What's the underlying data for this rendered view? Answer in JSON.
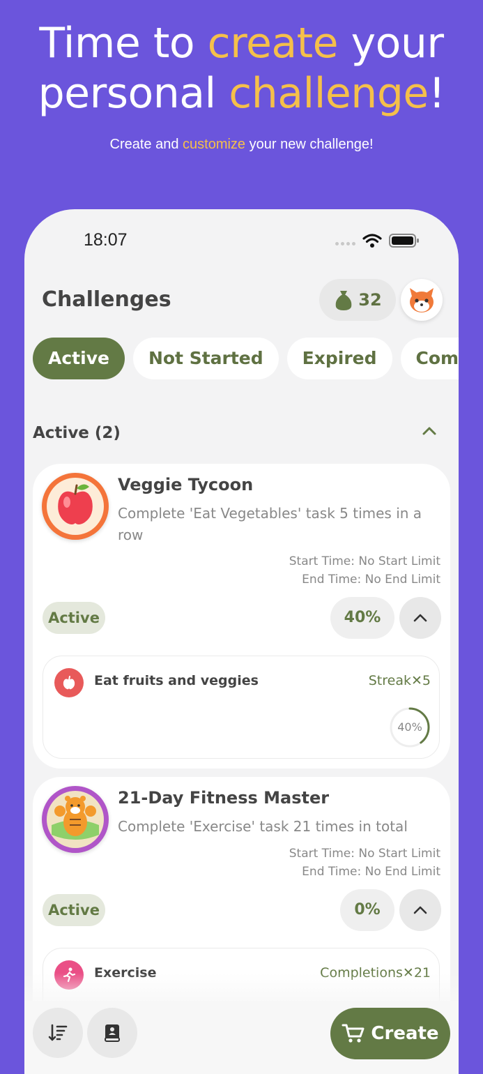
{
  "promo": {
    "title_1": "Time to ",
    "title_2": "create",
    "title_3": " your",
    "title_4": "personal ",
    "title_5": "challenge",
    "title_6": "!",
    "sub_1": "Create and ",
    "sub_2": "customize",
    "sub_3": " your new challenge!"
  },
  "status_bar": {
    "time": "18:07"
  },
  "header": {
    "title": "Challenges",
    "coins": "32"
  },
  "tabs": [
    {
      "label": "Active"
    },
    {
      "label": "Not Started"
    },
    {
      "label": "Expired"
    },
    {
      "label": "Complete"
    }
  ],
  "section": {
    "title": "Active (2)"
  },
  "challenges": [
    {
      "title": "Veggie Tycoon",
      "description": "Complete 'Eat Vegetables' task 5 times in a row",
      "start_time": "Start Time: No Start Limit",
      "end_time": "End Time: No End Limit",
      "status": "Active",
      "percent": "40%",
      "progress": 0.4,
      "task": {
        "name": "Eat fruits and veggies",
        "meta": "Streak✕5",
        "ring_label": "40%"
      }
    },
    {
      "title": "21-Day Fitness Master",
      "description": "Complete 'Exercise' task 21 times in total",
      "start_time": "Start Time: No Start Limit",
      "end_time": "End Time: No End Limit",
      "status": "Active",
      "percent": "0%",
      "progress": 0,
      "task": {
        "name": "Exercise",
        "meta": "Completions✕21"
      }
    }
  ],
  "bottom": {
    "create_label": "Create"
  },
  "colors": {
    "background": "#6b55dc",
    "accent": "#f5c04a",
    "primary_green": "#637a45"
  }
}
